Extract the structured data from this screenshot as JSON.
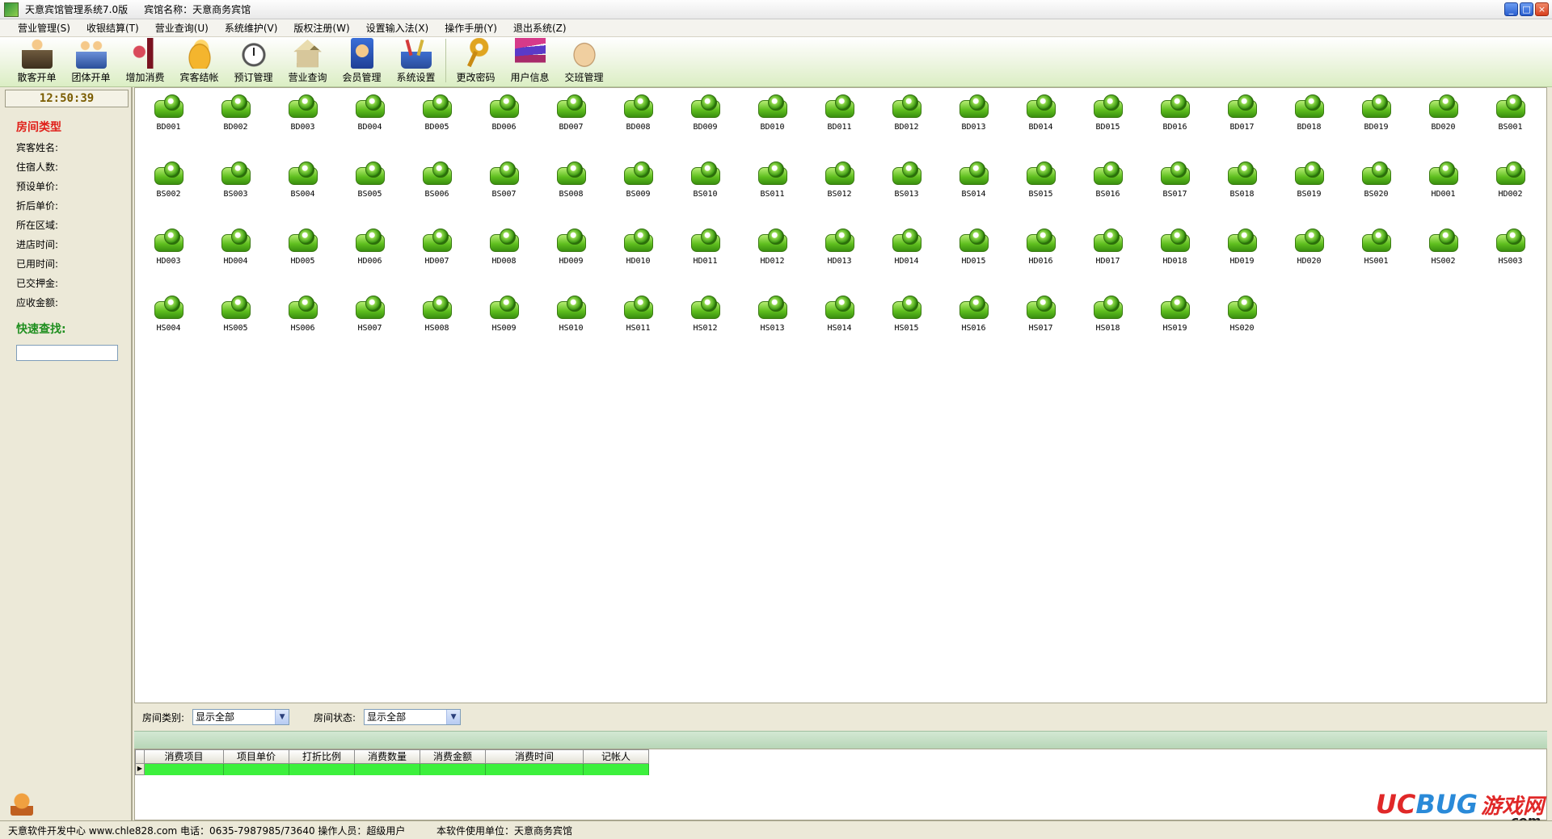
{
  "window": {
    "title": "天意宾馆管理系统7.0版",
    "hotel_name": "宾馆名称：天意商务宾馆"
  },
  "menu": [
    "营业管理(S)",
    "收银结算(T)",
    "营业查询(U)",
    "系统维护(V)",
    "版权注册(W)",
    "设置输入法(X)",
    "操作手册(Y)",
    "退出系统(Z)"
  ],
  "toolbar": [
    {
      "label": "散客开单",
      "icon": "person-icon"
    },
    {
      "label": "团体开单",
      "icon": "group-icon"
    },
    {
      "label": "增加消费",
      "icon": "wine-icon"
    },
    {
      "label": "宾客结帐",
      "icon": "coins-icon"
    },
    {
      "label": "预订管理",
      "icon": "clock-icon"
    },
    {
      "label": "营业查询",
      "icon": "house-icon"
    },
    {
      "label": "会员管理",
      "icon": "member-icon"
    },
    {
      "label": "系统设置",
      "icon": "tools-icon"
    },
    {
      "label": "更改密码",
      "icon": "key-icon"
    },
    {
      "label": "用户信息",
      "icon": "books-icon"
    },
    {
      "label": "交班管理",
      "icon": "handshake-icon"
    }
  ],
  "left_panel": {
    "clock": "12:50:39",
    "room_type_title": "房间类型",
    "fields": [
      "宾客姓名:",
      "住宿人数:",
      "预设单价:",
      "折后单价:",
      "所在区域:",
      "进店时间:",
      "已用时间:",
      "已交押金:",
      "应收金额:"
    ],
    "quick_search_title": "快速查找:"
  },
  "rooms": [
    "BD001",
    "BD002",
    "BD003",
    "BD004",
    "BD005",
    "BD006",
    "BD007",
    "BD008",
    "BD009",
    "BD010",
    "BD011",
    "BD012",
    "BD013",
    "BD014",
    "BD015",
    "BD016",
    "BD017",
    "BD018",
    "BD019",
    "BD020",
    "BS001",
    "BS002",
    "BS003",
    "BS004",
    "BS005",
    "BS006",
    "BS007",
    "BS008",
    "BS009",
    "BS010",
    "BS011",
    "BS012",
    "BS013",
    "BS014",
    "BS015",
    "BS016",
    "BS017",
    "BS018",
    "BS019",
    "BS020",
    "HD001",
    "HD002",
    "HD003",
    "HD004",
    "HD005",
    "HD006",
    "HD007",
    "HD008",
    "HD009",
    "HD010",
    "HD011",
    "HD012",
    "HD013",
    "HD014",
    "HD015",
    "HD016",
    "HD017",
    "HD018",
    "HD019",
    "HD020",
    "HS001",
    "HS002",
    "HS003",
    "HS004",
    "HS005",
    "HS006",
    "HS007",
    "HS008",
    "HS009",
    "HS010",
    "HS011",
    "HS012",
    "HS013",
    "HS014",
    "HS015",
    "HS016",
    "HS017",
    "HS018",
    "HS019",
    "HS020"
  ],
  "filters": {
    "category_label": "房间类别:",
    "category_value": "显示全部",
    "status_label": "房间状态:",
    "status_value": "显示全部"
  },
  "table": {
    "columns": [
      "消费项目",
      "项目单价",
      "打折比例",
      "消费数量",
      "消费金额",
      "消费时间",
      "记帐人"
    ]
  },
  "statusbar": {
    "left": "天意软件开发中心 www.chle828.com 电话：0635-7987985/73640  操作人员：超级用户",
    "right": "本软件使用单位：天意商务宾馆"
  },
  "watermark": {
    "uc": "UC",
    "bug": "BUG",
    "cn": "游戏网",
    "com": ".com"
  }
}
